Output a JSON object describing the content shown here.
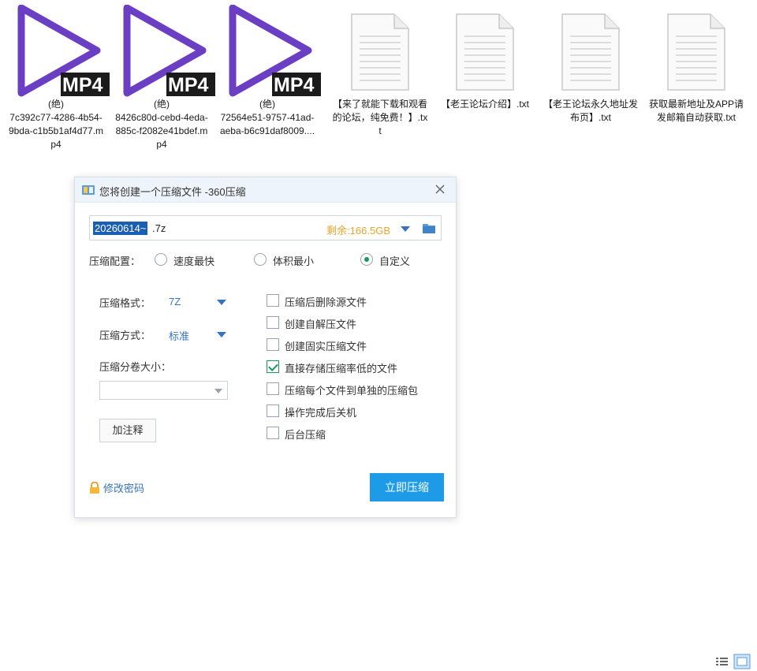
{
  "files": [
    {
      "type": "mp4",
      "badge": "MP4",
      "name_line1": "(绝)",
      "name": "7c392c77-4286-4b54-9bda-c1b5b1af4d77.mp4"
    },
    {
      "type": "mp4",
      "badge": "MP4",
      "name_line1": "(绝)",
      "name": "8426c80d-cebd-4eda-885c-f2082e41bdef.mp4"
    },
    {
      "type": "mp4",
      "badge": "MP4",
      "name_line1": "(绝)",
      "name": "72564e51-9757-41ad-aeba-b6c91daf8009...."
    },
    {
      "type": "txt",
      "name": "【来了就能下载和观看的论坛，纯免费！】.txt"
    },
    {
      "type": "txt",
      "name": "【老王论坛介绍】.txt"
    },
    {
      "type": "txt",
      "name": "【老王论坛永久地址发布页】.txt"
    },
    {
      "type": "txt",
      "name": "获取最新地址及APP请发邮箱自动获取.txt"
    }
  ],
  "dialog": {
    "title": "您将创建一个压缩文件 -360压缩",
    "filename_selected": "20260614~",
    "filename_rest": ".7z",
    "free_space": "剩余:166.5GB",
    "config_label": "压缩配置：",
    "radio_options": [
      {
        "label": "速度最快",
        "selected": false
      },
      {
        "label": "体积最小",
        "selected": false
      },
      {
        "label": "自定义",
        "selected": true
      }
    ],
    "format_label": "压缩格式：",
    "format_value": "7Z",
    "method_label": "压缩方式：",
    "method_value": "标准",
    "volume_label": "压缩分卷大小：",
    "volume_value": "",
    "comment_button": "加注释",
    "options": [
      {
        "label": "压缩后删除源文件",
        "checked": false
      },
      {
        "label": "创建自解压文件",
        "checked": false
      },
      {
        "label": "创建固实压缩文件",
        "checked": false
      },
      {
        "label": "直接存储压缩率低的文件",
        "checked": true
      },
      {
        "label": "压缩每个文件到单独的压缩包",
        "checked": false
      },
      {
        "label": "操作完成后关机",
        "checked": false
      },
      {
        "label": "后台压缩",
        "checked": false
      }
    ],
    "password_link": "修改密码",
    "compress_button": "立即压缩"
  },
  "colors": {
    "accent": "#1e9be8",
    "mp4_purple": "#6a3fc4",
    "link": "#3573c3",
    "free_space": "#e8a52b",
    "check_green": "#1a9a57"
  }
}
